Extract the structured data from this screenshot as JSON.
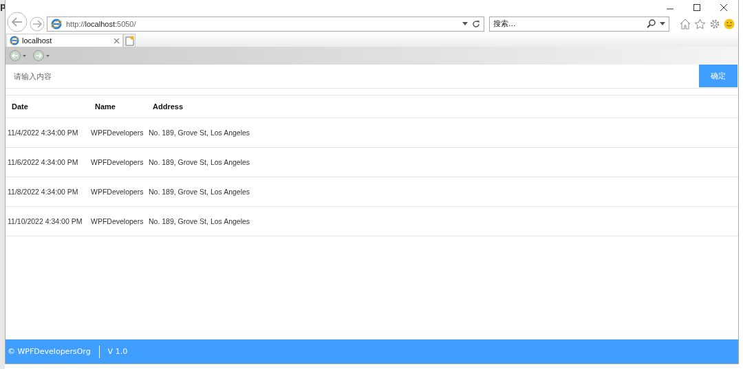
{
  "background_text": "p",
  "browser": {
    "url_scheme": "http://",
    "url_host": "localhost",
    "url_rest": ":5050/",
    "search_placeholder": "搜索...",
    "tab": {
      "title": "localhost",
      "selected": true
    }
  },
  "search": {
    "placeholder": "请输入内容",
    "button": "确定"
  },
  "table": {
    "columns": [
      "Date",
      "Name",
      "Address"
    ],
    "rows": [
      {
        "date": "11/4/2022 4:34:00 PM",
        "name": "WPFDevelopers",
        "address": "No. 189, Grove St, Los Angeles"
      },
      {
        "date": "11/6/2022 4:34:00 PM",
        "name": "WPFDevelopers",
        "address": "No. 189, Grove St, Los Angeles"
      },
      {
        "date": "11/8/2022 4:34:00 PM",
        "name": "WPFDevelopers",
        "address": "No. 189, Grove St, Los Angeles"
      },
      {
        "date": "11/10/2022 4:34:00 PM",
        "name": "WPFDevelopers",
        "address": "No. 189, Grove St, Los Angeles"
      }
    ]
  },
  "footer": {
    "copyright": "© WPFDevelopersOrg",
    "version": "V 1.0"
  }
}
